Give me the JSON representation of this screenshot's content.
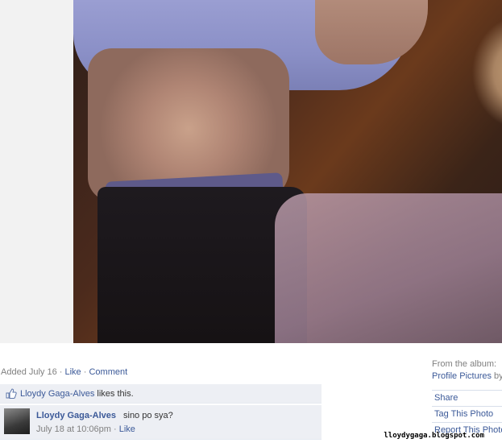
{
  "photo": {
    "icon": "photo"
  },
  "added": {
    "text": "Added July 16",
    "sep1": " · ",
    "like": "Like",
    "sep2": " · ",
    "comment": "Comment"
  },
  "album": {
    "from_label": "From the album:",
    "name": "Profile Pictures",
    "by": "by"
  },
  "actions": [
    {
      "label": "Share"
    },
    {
      "label": "Tag This Photo"
    },
    {
      "label": "Report This Photo"
    }
  ],
  "likes": {
    "icon": "thumbs-up-icon",
    "name": "Lloydy Gaga-Alves",
    "suffix": " likes this."
  },
  "comment": {
    "author": "Lloydy Gaga-Alves",
    "text": "sino po sya?",
    "timestamp": "July 18 at 10:06pm",
    "sep": " · ",
    "like": "Like"
  },
  "watermark": "lloydygaga.blogspot.com"
}
